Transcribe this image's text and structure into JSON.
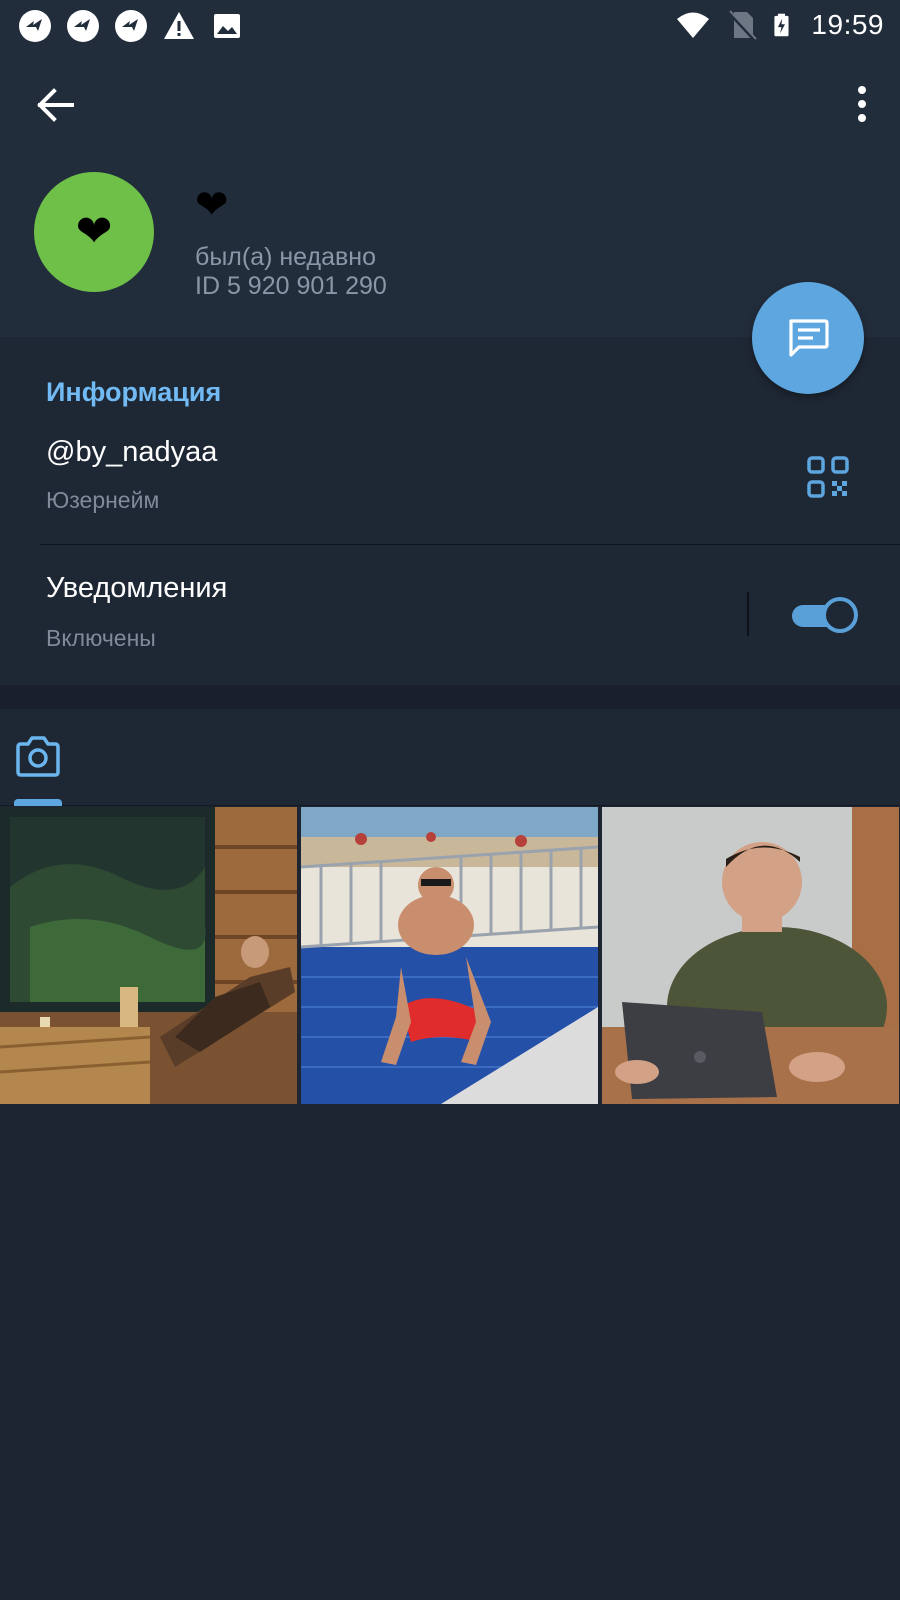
{
  "status_bar": {
    "time": "19:59",
    "left_icons": [
      "app-notification-icon",
      "app-notification-icon",
      "app-notification-icon",
      "warning-icon",
      "image-icon"
    ],
    "right_icons": [
      "wifi-icon",
      "no-sim-icon",
      "battery-charging-icon"
    ]
  },
  "header": {
    "back_icon": "arrow-left-icon",
    "menu_icon": "more-vertical-icon",
    "avatar_glyph": "❤",
    "avatar_color": "#6fc048",
    "name": "❤",
    "status": "был(а) недавно",
    "id": "ID 5 920 901 290"
  },
  "fab": {
    "icon": "message-icon",
    "color": "#5ea6e0"
  },
  "info": {
    "title": "Информация",
    "username": {
      "value": "@by_nadyaa",
      "caption": "Юзернейм",
      "icon": "qr-code-icon"
    },
    "notifications": {
      "value": "Уведомления",
      "caption": "Включены",
      "enabled": true
    }
  },
  "media": {
    "tabs": [
      {
        "icon": "camera-icon",
        "active": true
      }
    ],
    "photos": [
      {
        "subject": "sauna-photo"
      },
      {
        "subject": "pool-photo"
      },
      {
        "subject": "laptop-photo"
      }
    ]
  },
  "colors": {
    "accent": "#5ea6e0",
    "section_title": "#71baf3",
    "background": "#1d2533"
  }
}
